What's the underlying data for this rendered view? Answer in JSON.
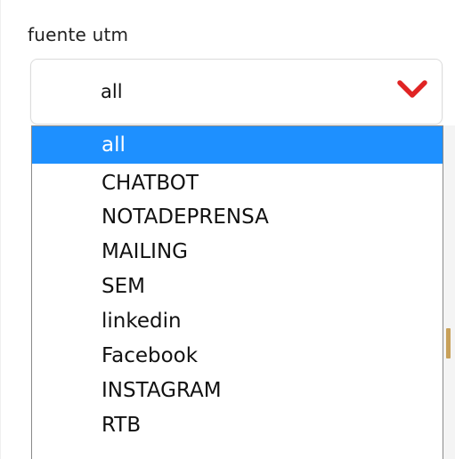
{
  "field": {
    "label": "fuente utm",
    "selected_value": "all"
  },
  "dropdown": {
    "options": [
      "all",
      "CHATBOT",
      "NOTADEPRENSA",
      "MAILING",
      "SEM",
      "linkedin",
      "Facebook",
      "INSTAGRAM",
      "RTB"
    ],
    "highlighted_index": 0
  },
  "icons": {
    "chevron": "chevron-down-icon"
  },
  "colors": {
    "highlight": "#1e90ff",
    "chevron": "#e02424"
  }
}
